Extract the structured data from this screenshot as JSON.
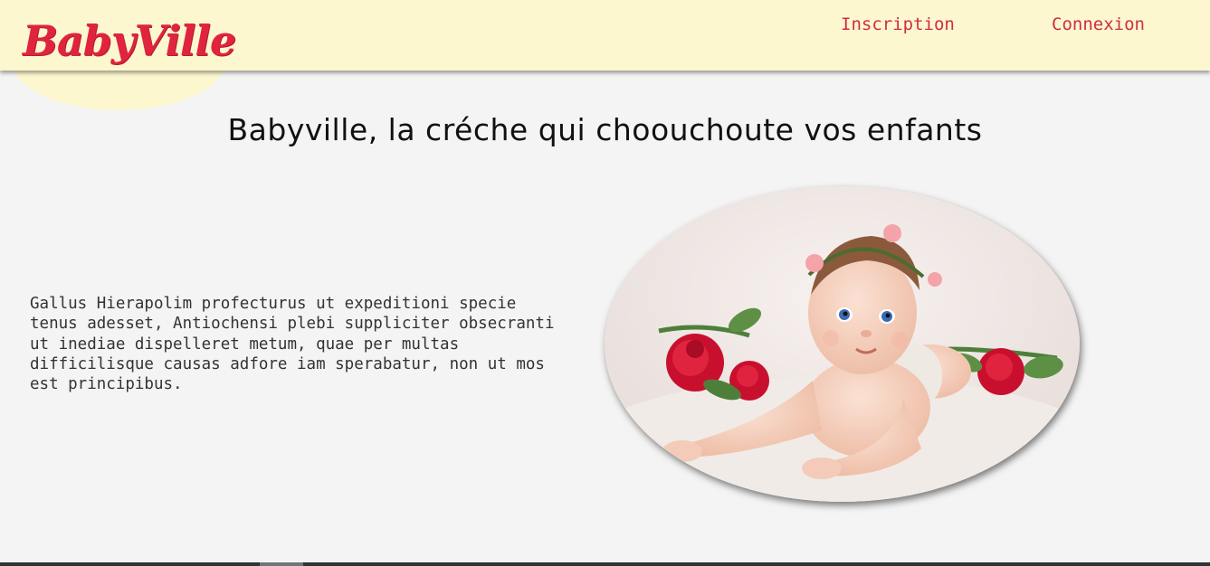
{
  "header": {
    "logo_text": "BabyVille",
    "nav": {
      "inscription": "Inscription",
      "connexion": "Connexion"
    }
  },
  "main": {
    "title": "Babyville, la créche qui choouchoute vos enfants",
    "intro": "Gallus Hierapolim profecturus ut expeditioni specie tenus adesset, Antiochensi plebi suppliciter obsecranti ut inediae dispelleret metum, quae per multas difficilisque causas adfore iam sperabatur, non ut mos est principibus.",
    "hero_image": "baby-with-roses-photo"
  },
  "colors": {
    "header_bg": "#fcf7cf",
    "accent": "#d12c45",
    "page_bg": "#f4f4f4"
  }
}
